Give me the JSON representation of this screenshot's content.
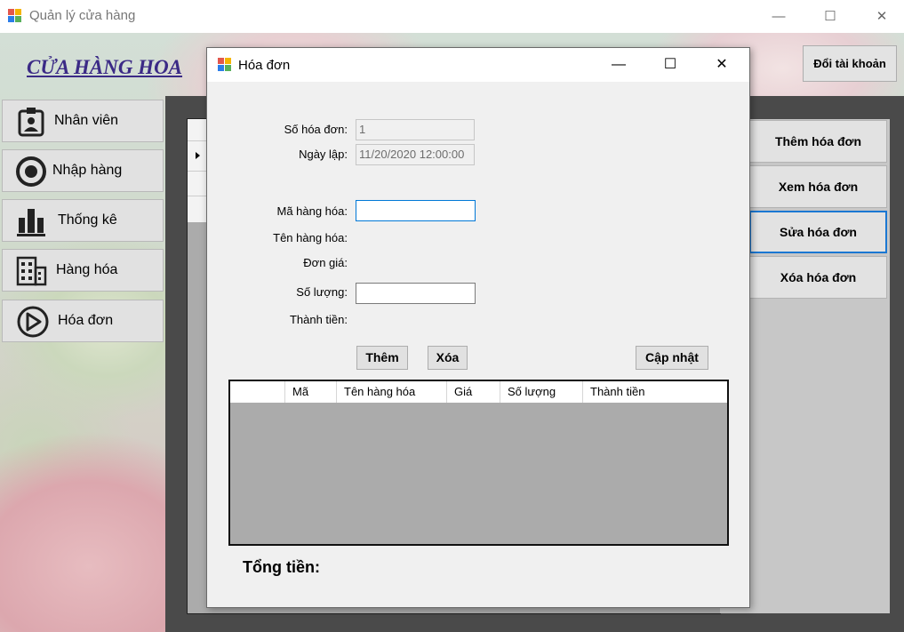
{
  "window": {
    "title": "Quản lý cửa hàng",
    "minimize": "—",
    "maximize": "☐",
    "close": "✕"
  },
  "main": {
    "shop_title": "CỬA HÀNG HOA",
    "account_button": "Đổi tài khoản",
    "nav": [
      {
        "label": "Nhân viên",
        "icon": "employee-badge-icon"
      },
      {
        "label": "Nhập hàng",
        "icon": "import-target-icon"
      },
      {
        "label": "Thống kê",
        "icon": "statistics-bar-icon"
      },
      {
        "label": "Hàng hóa",
        "icon": "products-building-icon"
      },
      {
        "label": "Hóa đơn",
        "icon": "invoice-play-icon"
      }
    ],
    "actions": [
      "Thêm hóa đơn",
      "Xem hóa đơn",
      "Sửa hóa đơn",
      "Xóa hóa đơn"
    ]
  },
  "dialog": {
    "title": "Hóa đơn",
    "minimize": "—",
    "maximize": "☐",
    "close": "✕",
    "fields": {
      "invoice_no_label": "Số hóa đơn:",
      "invoice_no_value": "1",
      "date_label": "Ngày lập:",
      "date_value": "11/20/2020 12:00:00",
      "product_code_label": "Mã hàng hóa:",
      "product_code_value": "",
      "product_name_label": "Tên hàng hóa:",
      "unit_price_label": "Đơn giá:",
      "quantity_label": "Số lượng:",
      "quantity_value": "",
      "amount_label": "Thành tiền:"
    },
    "buttons": {
      "add": "Thêm",
      "delete": "Xóa",
      "update": "Cập nhật"
    },
    "grid_columns": [
      "Mã",
      "Tên hàng hóa",
      "Giá",
      "Số lượng",
      "Thành tiền"
    ],
    "total_label": "Tổng tiền:"
  },
  "colors": {
    "shop_title": "#3b2a86",
    "focus_border": "#1a77d2",
    "grid_bg": "#ababab"
  }
}
